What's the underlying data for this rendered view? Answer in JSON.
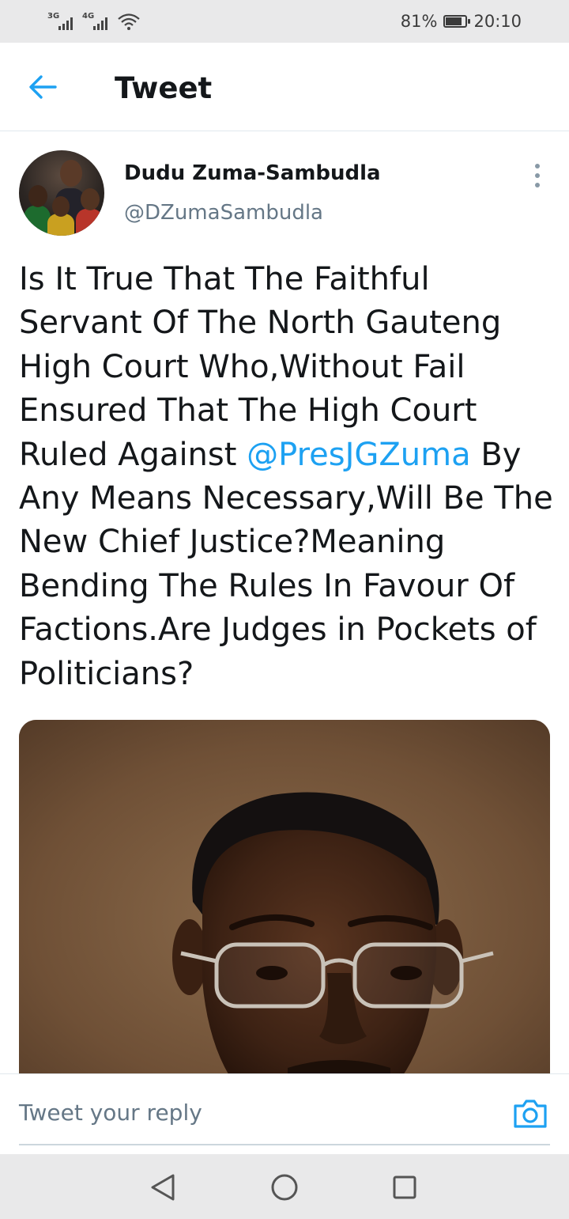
{
  "status_bar": {
    "network_1": "3G",
    "network_2": "4G",
    "battery_text": "81%",
    "battery_level": 0.81,
    "time": "20:10"
  },
  "header": {
    "title": "Tweet",
    "back_icon": "arrow-left-icon",
    "accent_color": "#1da1f2"
  },
  "tweet": {
    "author_name": "Dudu Zuma-Sambudla",
    "author_handle": "@DZumaSambudla",
    "text_before_mention": "Is It True That The Faithful Servant Of The North Gauteng High Court Who,Without Fail Ensured That The High Court Ruled Against ",
    "mention": "@PresJGZuma",
    "text_after_mention": " By Any Means Necessary,Will Be The New Chief Justice?Meaning Bending The Rules In Favour Of Factions.Are Judges in Pockets of Politicians?",
    "more_icon": "more-vertical-icon"
  },
  "reply": {
    "placeholder": "Tweet your reply",
    "camera_icon": "camera-icon"
  },
  "nav": {
    "back_icon": "triangle-back-icon",
    "home_icon": "circle-home-icon",
    "recents_icon": "square-recents-icon"
  }
}
